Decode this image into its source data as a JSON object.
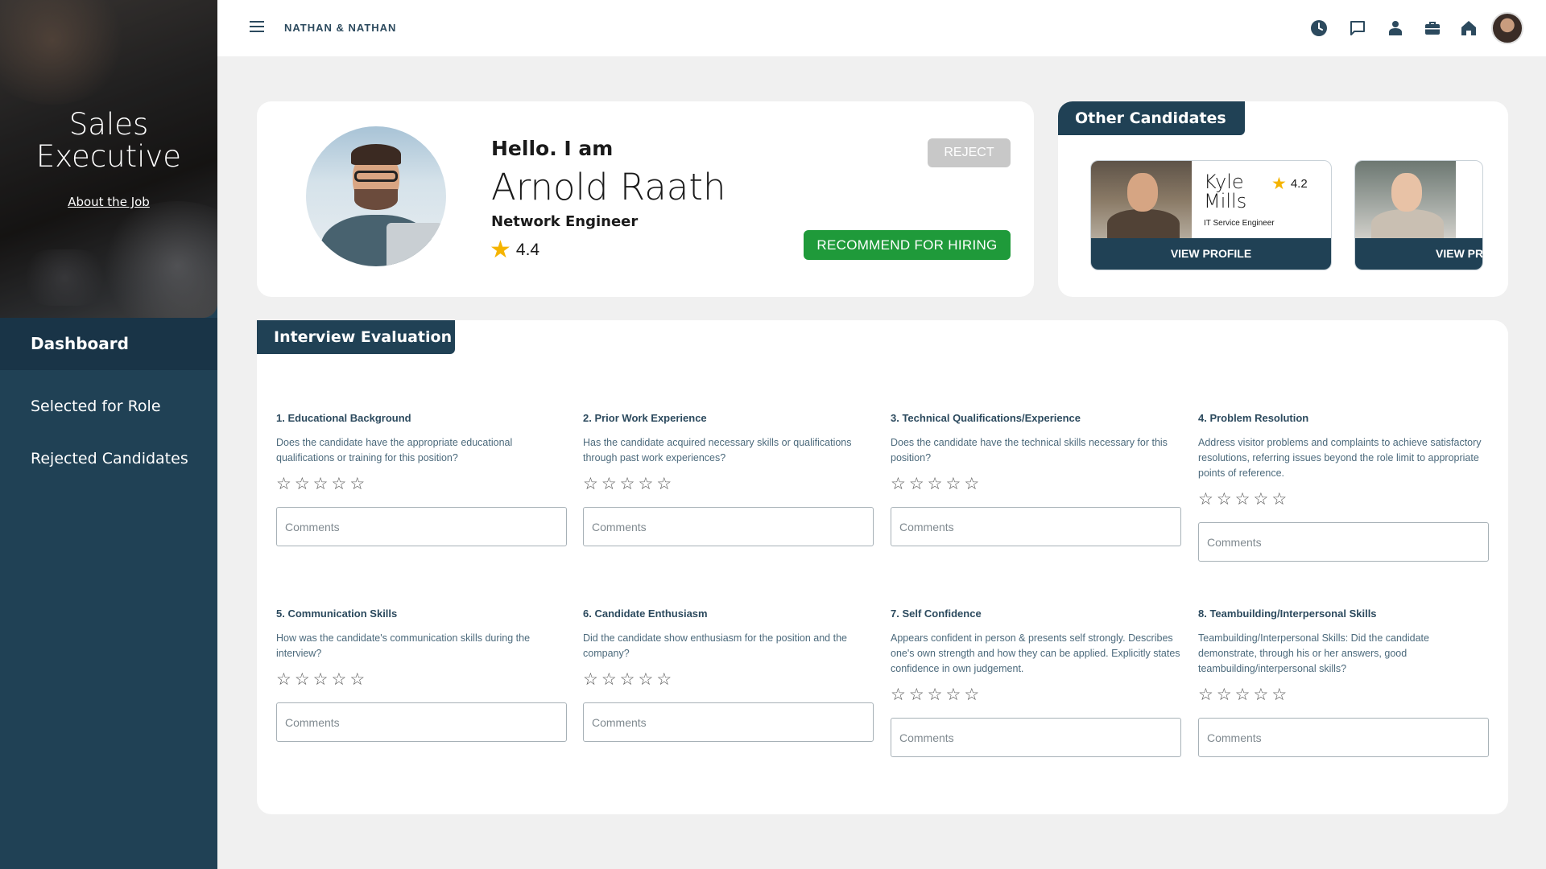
{
  "sidebar": {
    "job_title": "Sales Executive",
    "about_link": "About the Job",
    "items": [
      {
        "label": "Dashboard",
        "active": true
      },
      {
        "label": "Selected for Role"
      },
      {
        "label": "Rejected Candidates"
      }
    ]
  },
  "topbar": {
    "brand": "NATHAN & NATHAN",
    "icons": [
      "clock-icon",
      "chat-icon",
      "user-icon",
      "briefcase-icon",
      "home-icon",
      "avatar"
    ]
  },
  "profile": {
    "greeting": "Hello. I am",
    "name": "Arnold Raath",
    "role": "Network Engineer",
    "rating": "4.4",
    "reject_label": "REJECT",
    "recommend_label": "RECOMMEND FOR HIRING"
  },
  "other_candidates": {
    "title": "Other Candidates",
    "items": [
      {
        "first": "Kyle",
        "last": "Mills",
        "role": "IT Service Engineer",
        "rating": "4.2",
        "button": "VIEW PROFILE"
      },
      {
        "button": "VIEW PROFILE"
      }
    ]
  },
  "evaluation": {
    "title": "Interview Evaluation",
    "comment_placeholder": "Comments",
    "questions": [
      {
        "title": "1. Educational Background",
        "description": "Does the candidate have the appropriate educational qualifications or training for this position?"
      },
      {
        "title": "2. Prior Work Experience",
        "description": "Has the candidate acquired necessary skills or qualifications through past work experiences?"
      },
      {
        "title": "3. Technical Qualifications/Experience",
        "description": "Does the candidate have the technical skills necessary for this position?"
      },
      {
        "title": "4. Problem Resolution",
        "description": "Address visitor problems and complaints to achieve satisfactory resolutions, referring issues beyond the role limit to appropriate points of reference."
      },
      {
        "title": "5. Communication Skills",
        "description": "How was the candidate's communication skills during the interview?"
      },
      {
        "title": "6. Candidate Enthusiasm",
        "description": "Did the candidate show enthusiasm for the position and the company?"
      },
      {
        "title": "7. Self Confidence",
        "description": "Appears confident in person & presents self strongly. Describes one's own strength and how they can be applied. Explicitly states confidence in own judgement."
      },
      {
        "title": "8. Teambuilding/Interpersonal Skills",
        "description": "Teambuilding/Interpersonal Skills: Did the candidate demonstrate, through his or her answers, good teambuilding/interpersonal skills?"
      }
    ]
  },
  "colors": {
    "sidebar": "#204155",
    "accent_green": "#1f9a3a",
    "reject_gray": "#c8c8c8",
    "star": "#f5b400"
  }
}
